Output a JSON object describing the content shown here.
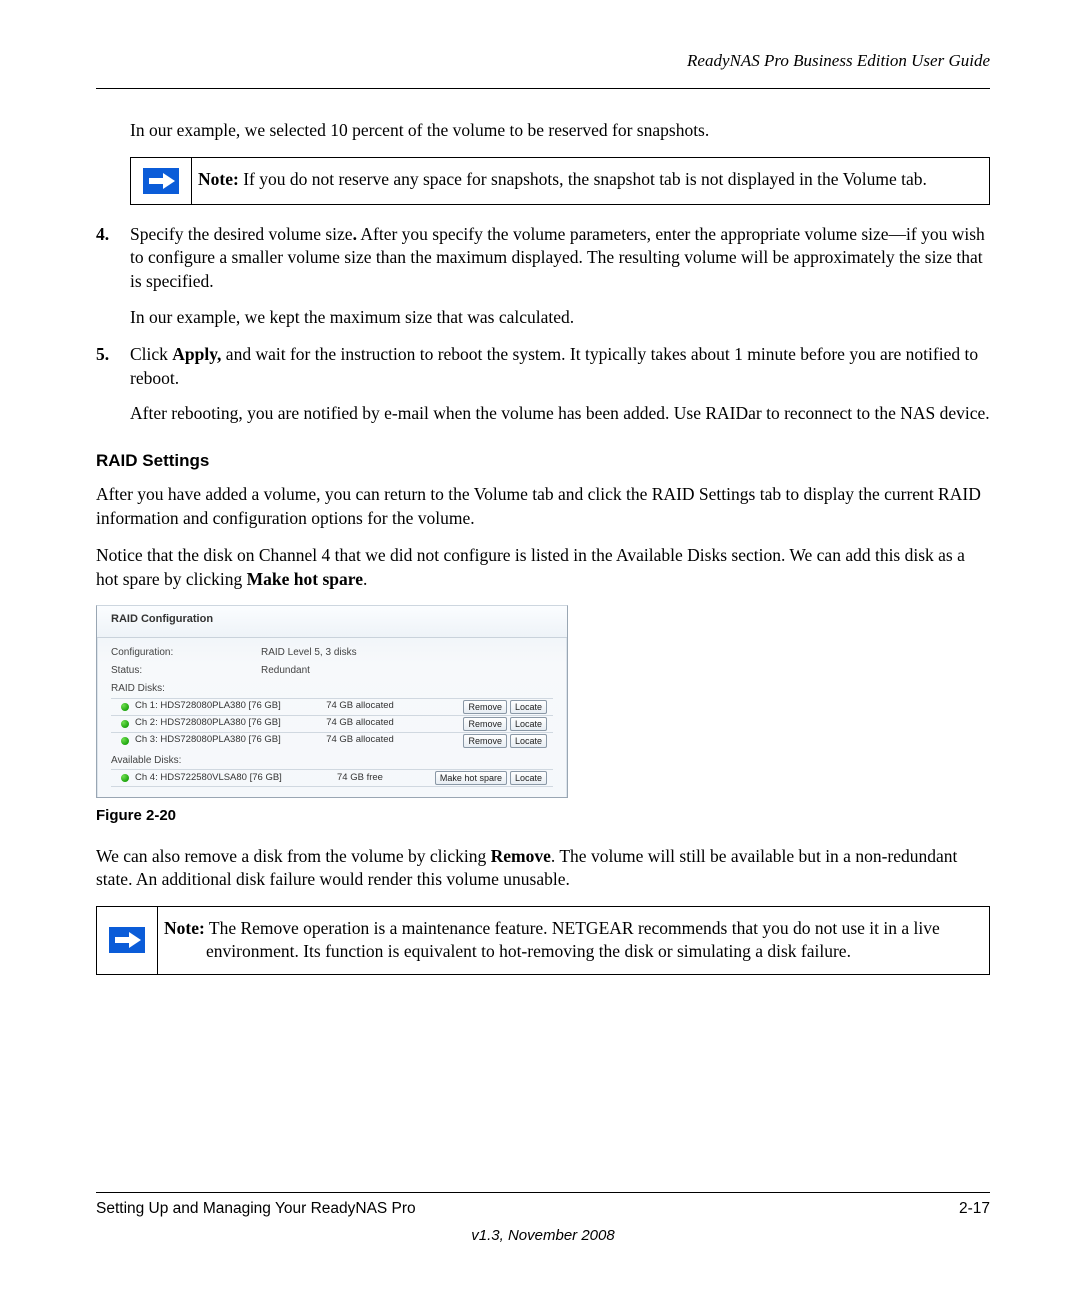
{
  "header": {
    "title": "ReadyNAS Pro Business Edition User Guide"
  },
  "intro": "In our example, we selected 10 percent of the volume to be reserved for snapshots.",
  "note1": {
    "label": "Note:",
    "text": "If you do not reserve any space for snapshots, the snapshot tab is not displayed in the Volume tab."
  },
  "steps": [
    {
      "num": "4.",
      "lead_before_bold": "Specify the desired volume size",
      "bold_punct": ".",
      "after": " After you specify the volume parameters, enter the appropriate volume size—if you wish to configure a smaller volume size than the maximum displayed. The resulting volume will be approximately the size that is specified.",
      "para2": "In our example, we kept the maximum size that was calculated."
    },
    {
      "num": "5.",
      "lead": "Click ",
      "bold": "Apply,",
      "after": " and wait for the instruction to reboot the system. It typically takes about 1 minute before you are notified to reboot.",
      "para2": "After rebooting, you are notified by e-mail when the volume has been added. Use RAIDar to reconnect to the NAS device."
    }
  ],
  "section_title": "RAID Settings",
  "para_a": "After you have added a volume, you can return to the Volume tab and click the RAID Settings tab to display the current RAID information and configuration options for the volume.",
  "para_b_before": "Notice that the disk on Channel 4 that we did not configure is listed in the Available Disks section. We can add this disk as a hot spare by clicking ",
  "para_b_bold": "Make hot spare",
  "para_b_after": ".",
  "raid": {
    "panel_title": "RAID Configuration",
    "config_label": "Configuration:",
    "config_value": "RAID Level 5, 3 disks",
    "status_label": "Status:",
    "status_value": "Redundant",
    "raid_disks_label": "RAID Disks:",
    "disks": [
      {
        "name": "Ch 1: HDS728080PLA380 [76 GB]",
        "alloc": "74 GB allocated",
        "btn1": "Remove",
        "btn2": "Locate"
      },
      {
        "name": "Ch 2: HDS728080PLA380 [76 GB]",
        "alloc": "74 GB allocated",
        "btn1": "Remove",
        "btn2": "Locate"
      },
      {
        "name": "Ch 3: HDS728080PLA380 [76 GB]",
        "alloc": "74 GB allocated",
        "btn1": "Remove",
        "btn2": "Locate"
      }
    ],
    "avail_label": "Available Disks:",
    "avail": [
      {
        "name": "Ch 4: HDS722580VLSA80 [76 GB]",
        "alloc": "74 GB free",
        "btn1": "Make hot spare",
        "btn2": "Locate"
      }
    ]
  },
  "figure_caption": "Figure 2-20",
  "para_c_before": "We can also remove a disk from the volume by clicking ",
  "para_c_bold": "Remove",
  "para_c_after": ". The volume will still be available but in a non-redundant state. An additional disk failure would render this volume unusable.",
  "note2": {
    "label": "Note:",
    "text": "The Remove operation is a maintenance feature. NETGEAR recommends that you do not use it in a live environment. Its function is equivalent to hot-removing the disk or simulating a disk failure."
  },
  "footer": {
    "left": "Setting Up and Managing Your ReadyNAS Pro",
    "right": "2-17",
    "version": "v1.3, November 2008"
  }
}
